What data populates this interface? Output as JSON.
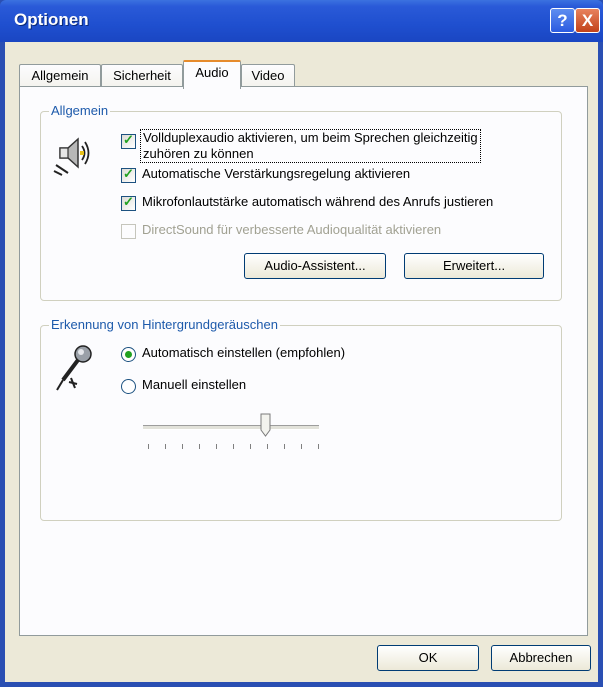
{
  "window": {
    "title": "Optionen"
  },
  "titlebar": {
    "help_label": "?",
    "close_label": "X"
  },
  "tabs": [
    {
      "label": "Allgemein",
      "active": false
    },
    {
      "label": "Sicherheit",
      "active": false
    },
    {
      "label": "Audio",
      "active": true
    },
    {
      "label": "Video",
      "active": false
    }
  ],
  "group_general": {
    "label": "Allgemein",
    "checkboxes": [
      {
        "line1": "Vollduplexaudio aktivieren, um beim Sprechen gleichzeitig",
        "line2": "zuhören zu können",
        "checked": true,
        "disabled": false
      },
      {
        "label": "Automatische Verstärkungsregelung aktivieren",
        "checked": true,
        "disabled": false
      },
      {
        "label": "Mikrofonlautstärke automatisch während des Anrufs justieren",
        "checked": true,
        "disabled": false
      },
      {
        "label": "DirectSound für verbesserte Audioqualität aktivieren",
        "checked": false,
        "disabled": true
      }
    ],
    "buttons": {
      "assistant": "Audio-Assistent...",
      "advanced": "Erweitert..."
    },
    "icon": "speaker-icon"
  },
  "group_noise": {
    "label": "Erkennung von Hintergrundgeräuschen",
    "radios": [
      {
        "label": "Automatisch einstellen (empfohlen)",
        "selected": true
      },
      {
        "label": "Manuell einstellen",
        "selected": false
      }
    ],
    "icon": "microphone-icon",
    "slider_level": 0.7,
    "slider_ticks": 11
  },
  "footer": {
    "ok": "OK",
    "cancel": "Abbrechen"
  },
  "colors": {
    "title_bar": "#1f4fcf",
    "group_label": "#1d5aab",
    "check": "#21a121",
    "active_tab": "#e68b2c"
  }
}
